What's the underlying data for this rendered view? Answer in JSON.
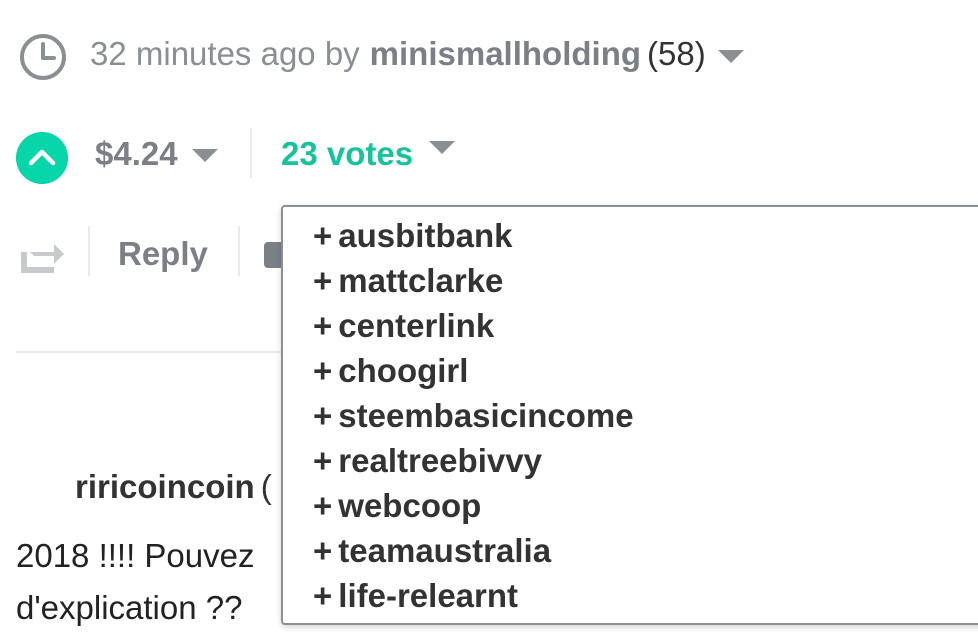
{
  "header": {
    "time_ago": "32 minutes ago by",
    "author": "minismallholding",
    "reputation": "(58)"
  },
  "votes": {
    "payout": "$4.24",
    "count_label": "23 votes"
  },
  "actions": {
    "reply_label": "Reply"
  },
  "comment": {
    "author": "riricoincoin",
    "reputation_partial": "(",
    "body_line1": "2018 !!!! Pouvez",
    "body_line2": "d'explication ??"
  },
  "voters": [
    "ausbitbank",
    "mattclarke",
    "centerlink",
    "choogirl",
    "steembasicincome",
    "realtreebivvy",
    "webcoop",
    "teamaustralia",
    "life-relearnt"
  ],
  "colors": {
    "accent": "#06d6a9",
    "vote_text": "#16c39c",
    "muted": "#8a8f94"
  }
}
